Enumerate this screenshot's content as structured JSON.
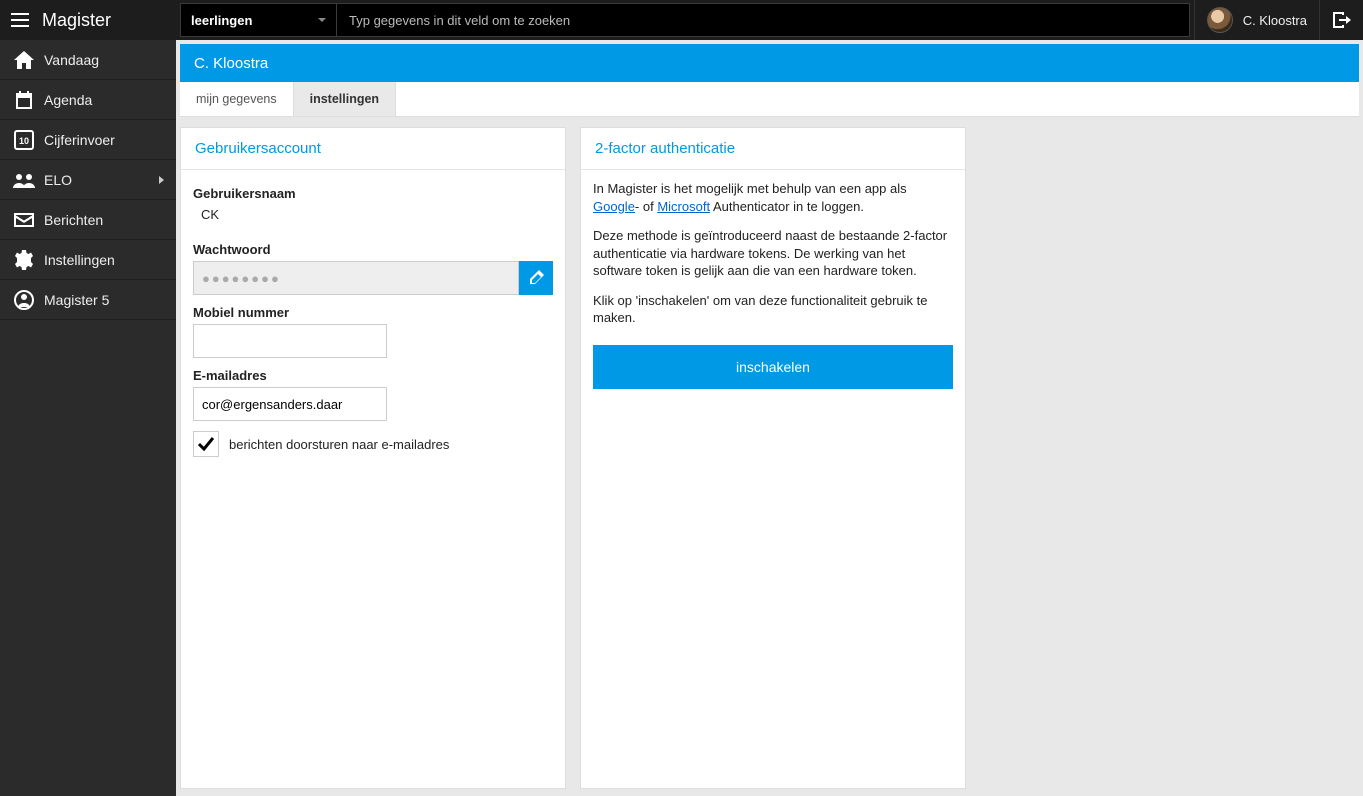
{
  "brand": "Magister",
  "search": {
    "category": "leerlingen",
    "placeholder": "Typ gegevens in dit veld om te zoeken"
  },
  "user": {
    "name": "C. Kloostra"
  },
  "sidebar": {
    "items": [
      {
        "label": "Vandaag"
      },
      {
        "label": "Agenda"
      },
      {
        "label": "Cijferinvoer"
      },
      {
        "label": "ELO"
      },
      {
        "label": "Berichten"
      },
      {
        "label": "Instellingen"
      },
      {
        "label": "Magister 5"
      }
    ]
  },
  "page": {
    "title": "C. Kloostra"
  },
  "tabs": [
    {
      "label": "mijn gegevens"
    },
    {
      "label": "instellingen"
    }
  ],
  "account": {
    "panel_title": "Gebruikersaccount",
    "username_label": "Gebruikersnaam",
    "username_value": "CK",
    "password_label": "Wachtwoord",
    "password_masked": "●●●●●●●●",
    "mobile_label": "Mobiel nummer",
    "mobile_value": "",
    "email_label": "E-mailadres",
    "email_value": "cor@ergensanders.daar",
    "forward_label": "berichten doorsturen naar e-mailadres"
  },
  "twofa": {
    "panel_title": "2-factor authenticatie",
    "p1_pre": "In Magister is het mogelijk met behulp van een app als ",
    "p1_link1": "Google",
    "p1_mid": "- of ",
    "p1_link2": "Microsoft",
    "p1_post": " Authenticator in te loggen.",
    "p2": "Deze methode is geïntroduceerd naast de bestaande 2-factor authenticatie via hardware tokens. De werking van het software token is gelijk aan die van een hardware token.",
    "p3": "Klik op 'inschakelen' om van deze functionaliteit gebruik te maken.",
    "enable_label": "inschakelen"
  }
}
